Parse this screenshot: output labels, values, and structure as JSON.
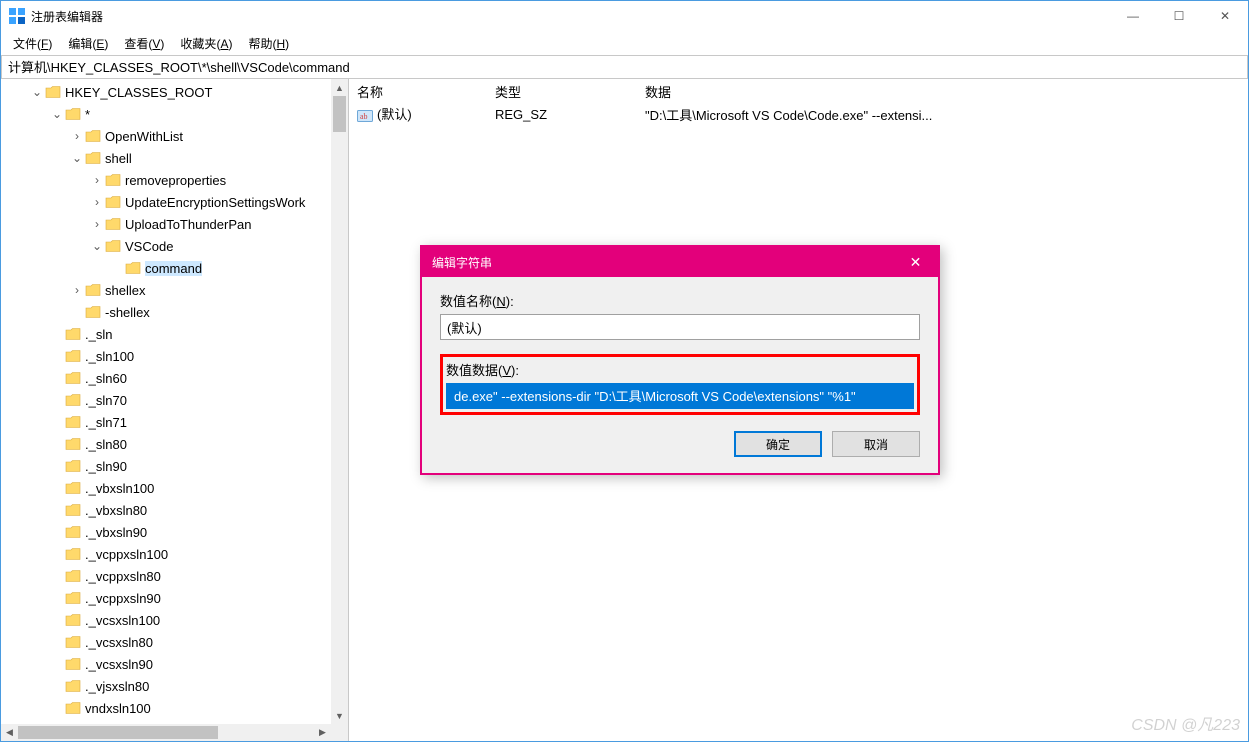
{
  "window": {
    "title": "注册表编辑器",
    "min": "—",
    "max": "☐",
    "close": "✕"
  },
  "menu": [
    {
      "label": "文件",
      "hot": "F"
    },
    {
      "label": "编辑",
      "hot": "E"
    },
    {
      "label": "查看",
      "hot": "V"
    },
    {
      "label": "收藏夹",
      "hot": "A"
    },
    {
      "label": "帮助",
      "hot": "H"
    }
  ],
  "address": "计算机\\HKEY_CLASSES_ROOT\\*\\shell\\VSCode\\command",
  "tree": [
    {
      "depth": 0,
      "chev": "v",
      "label": "HKEY_CLASSES_ROOT"
    },
    {
      "depth": 1,
      "chev": "v",
      "label": "*"
    },
    {
      "depth": 2,
      "chev": ">",
      "label": "OpenWithList"
    },
    {
      "depth": 2,
      "chev": "v",
      "label": "shell"
    },
    {
      "depth": 3,
      "chev": ">",
      "label": "removeproperties"
    },
    {
      "depth": 3,
      "chev": ">",
      "label": "UpdateEncryptionSettingsWork"
    },
    {
      "depth": 3,
      "chev": ">",
      "label": "UploadToThunderPan"
    },
    {
      "depth": 3,
      "chev": "v",
      "label": "VSCode"
    },
    {
      "depth": 4,
      "chev": " ",
      "label": "command",
      "selected": true
    },
    {
      "depth": 2,
      "chev": ">",
      "label": "shellex"
    },
    {
      "depth": 2,
      "chev": " ",
      "label": "-shellex"
    },
    {
      "depth": 1,
      "chev": " ",
      "label": "._sln"
    },
    {
      "depth": 1,
      "chev": " ",
      "label": "._sln100"
    },
    {
      "depth": 1,
      "chev": " ",
      "label": "._sln60"
    },
    {
      "depth": 1,
      "chev": " ",
      "label": "._sln70"
    },
    {
      "depth": 1,
      "chev": " ",
      "label": "._sln71"
    },
    {
      "depth": 1,
      "chev": " ",
      "label": "._sln80"
    },
    {
      "depth": 1,
      "chev": " ",
      "label": "._sln90"
    },
    {
      "depth": 1,
      "chev": " ",
      "label": "._vbxsln100"
    },
    {
      "depth": 1,
      "chev": " ",
      "label": "._vbxsln80"
    },
    {
      "depth": 1,
      "chev": " ",
      "label": "._vbxsln90"
    },
    {
      "depth": 1,
      "chev": " ",
      "label": "._vcppxsln100"
    },
    {
      "depth": 1,
      "chev": " ",
      "label": "._vcppxsln80"
    },
    {
      "depth": 1,
      "chev": " ",
      "label": "._vcppxsln90"
    },
    {
      "depth": 1,
      "chev": " ",
      "label": "._vcsxsln100"
    },
    {
      "depth": 1,
      "chev": " ",
      "label": "._vcsxsln80"
    },
    {
      "depth": 1,
      "chev": " ",
      "label": "._vcsxsln90"
    },
    {
      "depth": 1,
      "chev": " ",
      "label": "._vjsxsln80"
    },
    {
      "depth": 1,
      "chev": " ",
      "label": "  vndxsln100"
    }
  ],
  "list": {
    "headers": {
      "name": "名称",
      "type": "类型",
      "data": "数据"
    },
    "rows": [
      {
        "name": "(默认)",
        "type": "REG_SZ",
        "data": "\"D:\\工具\\Microsoft VS Code\\Code.exe\" --extensi..."
      }
    ]
  },
  "dialog": {
    "title": "编辑字符串",
    "name_label_pre": "数值名称(",
    "name_hot": "N",
    "name_label_post": "):",
    "name_value": "(默认)",
    "data_label_pre": "数值数据(",
    "data_hot": "V",
    "data_label_post": "):",
    "data_value": "de.exe\" --extensions-dir \"D:\\工具\\Microsoft VS Code\\extensions\" \"%1\"",
    "ok": "确定",
    "cancel": "取消",
    "close": "✕"
  },
  "watermark": "CSDN @凡223"
}
